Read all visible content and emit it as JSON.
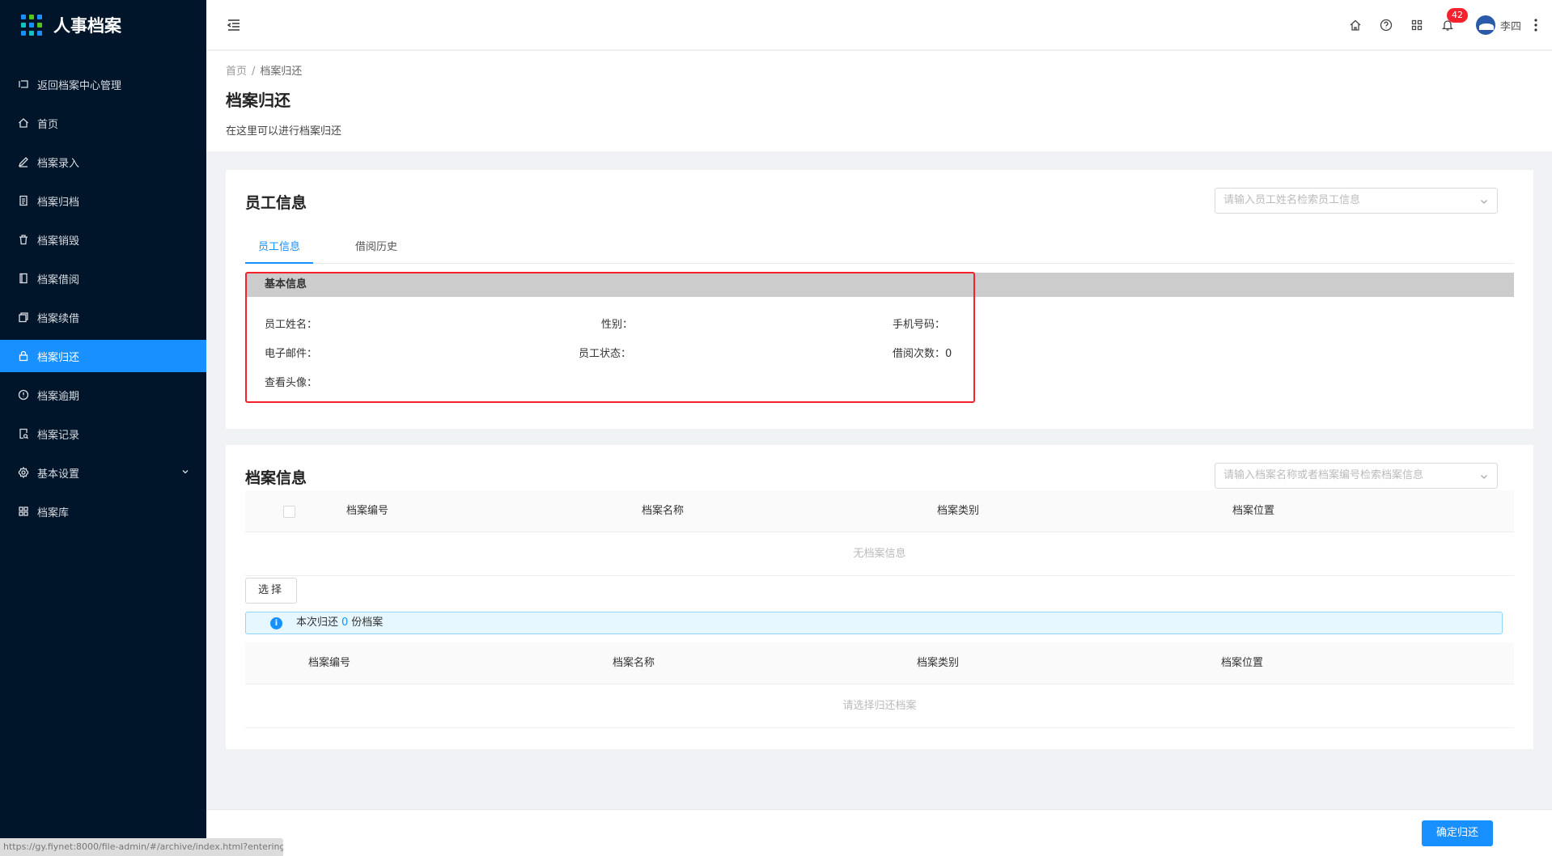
{
  "app": {
    "title": "人事档案"
  },
  "sidebar": {
    "items": [
      {
        "label": "返回档案中心管理",
        "icon": "return-icon"
      },
      {
        "label": "首页",
        "icon": "home-icon"
      },
      {
        "label": "档案录入",
        "icon": "edit-icon"
      },
      {
        "label": "档案归档",
        "icon": "file-icon"
      },
      {
        "label": "档案销毁",
        "icon": "trash-icon"
      },
      {
        "label": "档案借阅",
        "icon": "book-icon"
      },
      {
        "label": "档案续借",
        "icon": "copy-icon"
      },
      {
        "label": "档案归还",
        "icon": "lock-icon",
        "active": true
      },
      {
        "label": "档案逾期",
        "icon": "alert-circle-icon"
      },
      {
        "label": "档案记录",
        "icon": "file-search-icon"
      },
      {
        "label": "基本设置",
        "icon": "gear-icon",
        "has_children": true
      },
      {
        "label": "档案库",
        "icon": "grid-icon"
      }
    ],
    "status_url": "https://gy.fiynet:8000/file-admin/#/archive/index.html?entering/index"
  },
  "header": {
    "notification_count": "42",
    "username": "李四"
  },
  "page": {
    "breadcrumb": [
      "首页",
      "档案归还"
    ],
    "breadcrumb_sep": "/",
    "title": "档案归还",
    "description": "在这里可以进行档案归还"
  },
  "employee_card": {
    "title": "员工信息",
    "search_placeholder": "请输入员工姓名检索员工信息",
    "tabs": [
      "员工信息",
      "借阅历史"
    ],
    "section_title": "基本信息",
    "fields": {
      "name_label": "员工姓名：",
      "gender_label": "性别：",
      "phone_label": "手机号码：",
      "email_label": "电子邮件：",
      "status_label": "员工状态：",
      "borrow_count_label": "借阅次数：",
      "borrow_count_value": "0",
      "avatar_label": "查看头像："
    }
  },
  "archive_card": {
    "title": "档案信息",
    "search_placeholder": "请输入档案名称或者档案编号检索档案信息",
    "columns": [
      "档案编号",
      "档案名称",
      "档案类别",
      "档案位置"
    ],
    "empty_text": "无档案信息",
    "choose_button": "选择",
    "alert_prefix": "本次归还",
    "alert_count": "0",
    "alert_suffix": "份档案",
    "selected_columns": [
      "档案编号",
      "档案名称",
      "档案类别",
      "档案位置"
    ],
    "selected_empty_text": "请选择归还档案"
  },
  "footer": {
    "confirm_button": "确定归还"
  },
  "colors": {
    "primary": "#1890ff",
    "sidebar_bg": "#001529",
    "danger": "#f5222d"
  }
}
